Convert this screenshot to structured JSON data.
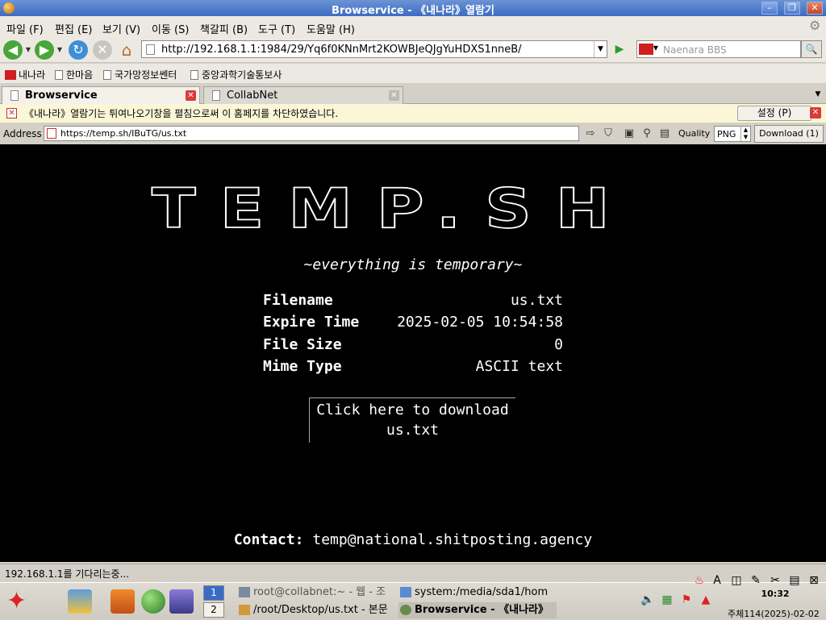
{
  "window": {
    "title": "Browservice - 《내나라》열람기"
  },
  "menu": [
    "파일 (F)",
    "편집 (E)",
    "보기 (V)",
    "이동 (S)",
    "책갈피 (B)",
    "도구 (T)",
    "도움말 (H)"
  ],
  "nav": {
    "url": "http://192.168.1.1:1984/29/Yq6f0KNnMrt2KOWBJeQJgYuHDXS1nneB/",
    "search_placeholder": "Naenara BBS"
  },
  "bookmarks": [
    "내나라",
    "한마음",
    "국가망정보쎈터",
    "중앙과학기술통보사"
  ],
  "tabs": [
    {
      "label": "Browservice",
      "active": true
    },
    {
      "label": "CollabNet",
      "active": false
    }
  ],
  "infobar": {
    "message": "《내나라》열람기는 튀여나오기창을 펼침으로써 이 홈페지를 차단하였습니다.",
    "settings_label": "설정 (P)"
  },
  "addressbar": {
    "label": "Address",
    "url": "https://temp.sh/IBuTG/us.txt",
    "quality_label": "Quality",
    "quality_value": "PNG",
    "download_label": "Download (1)"
  },
  "page": {
    "logo": "TEMP.SH",
    "tagline": "~everything is temporary~",
    "fields": [
      {
        "key": "Filename",
        "value": "us.txt"
      },
      {
        "key": "Expire Time",
        "value": "2025-02-05 10:54:58"
      },
      {
        "key": "File Size",
        "value": "0"
      },
      {
        "key": "Mime Type",
        "value": "ASCII text"
      }
    ],
    "download_line1": "Click here to download",
    "download_line2": "us.txt",
    "contact_label": "Contact:",
    "contact_value": "temp@national.shitposting.agency"
  },
  "status": {
    "text": "192.168.1.1를 기다리는중..."
  },
  "taskbar": {
    "desktops": [
      "1",
      "2"
    ],
    "tasks": [
      "root@collabnet:~ - 웹 - 조",
      "system:/media/sda1/hom",
      "/root/Desktop/us.txt - 본문",
      "Browservice - 《내나라》"
    ],
    "clock": "10:32",
    "date": "주체114(2025)-02-02"
  }
}
